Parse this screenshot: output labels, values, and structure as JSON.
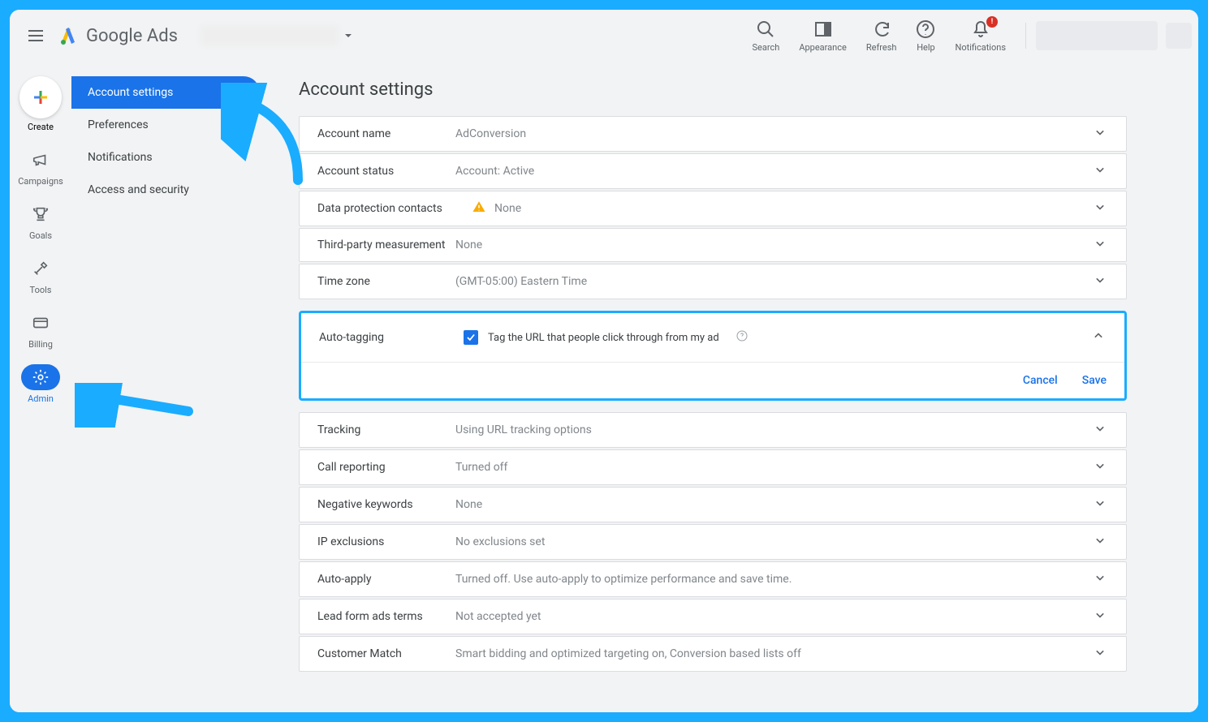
{
  "header": {
    "logo_text": "Google Ads",
    "tools": {
      "search": "Search",
      "appearance": "Appearance",
      "refresh": "Refresh",
      "help": "Help",
      "notifications": "Notifications"
    }
  },
  "leftrail": {
    "create": "Create",
    "campaigns": "Campaigns",
    "goals": "Goals",
    "tools": "Tools",
    "billing": "Billing",
    "admin": "Admin"
  },
  "subnav": {
    "account_settings": "Account settings",
    "preferences": "Preferences",
    "notifications": "Notifications",
    "access_security": "Access and security"
  },
  "page": {
    "title": "Account settings"
  },
  "settings": {
    "account_name": {
      "label": "Account name",
      "value": "AdConversion"
    },
    "account_status": {
      "label": "Account status",
      "value": "Account: Active"
    },
    "data_protection": {
      "label": "Data protection contacts",
      "value": "None"
    },
    "third_party": {
      "label": "Third-party measurement",
      "value": "None"
    },
    "time_zone": {
      "label": "Time zone",
      "value": "(GMT-05:00) Eastern Time"
    },
    "auto_tagging": {
      "label": "Auto-tagging",
      "checkbox_label": "Tag the URL that people click through from my ad",
      "cancel": "Cancel",
      "save": "Save"
    },
    "tracking": {
      "label": "Tracking",
      "value": "Using URL tracking options"
    },
    "call_reporting": {
      "label": "Call reporting",
      "value": "Turned off"
    },
    "negative_keywords": {
      "label": "Negative keywords",
      "value": "None"
    },
    "ip_exclusions": {
      "label": "IP exclusions",
      "value": "No exclusions set"
    },
    "auto_apply": {
      "label": "Auto-apply",
      "value": "Turned off. Use auto-apply to optimize performance and save time."
    },
    "lead_form": {
      "label": "Lead form ads terms",
      "value": "Not accepted yet"
    },
    "customer_match": {
      "label": "Customer Match",
      "value": "Smart bidding and optimized targeting on, Conversion based lists off"
    }
  }
}
